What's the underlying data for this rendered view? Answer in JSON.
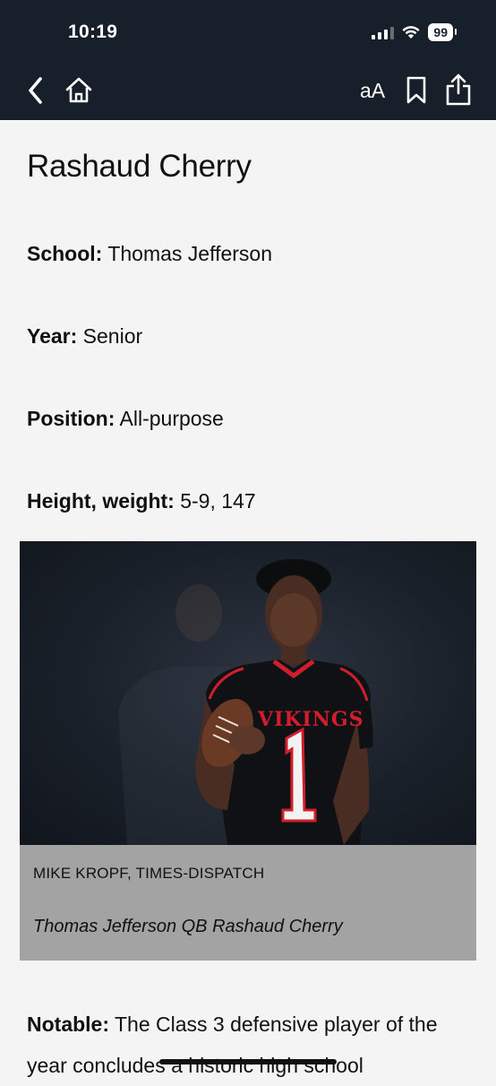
{
  "status_bar": {
    "time": "10:19",
    "battery": "99"
  },
  "toolbar": {
    "back_icon": "chevron-left-icon",
    "home_icon": "home-icon",
    "text_size_label": "aA",
    "bookmark_icon": "bookmark-icon",
    "share_icon": "share-icon"
  },
  "article": {
    "title": "Rashaud Cherry",
    "facts": [
      {
        "label": "School:",
        "value": "Thomas Jefferson"
      },
      {
        "label": "Year:",
        "value": "Senior"
      },
      {
        "label": "Position:",
        "value": "All-purpose"
      },
      {
        "label": "Height, weight:",
        "value": "5-9, 147"
      }
    ],
    "photo": {
      "jersey_text": "VIKINGS",
      "jersey_number": "1",
      "credit": "MIKE KROPF, TIMES-DISPATCH",
      "caption": "Thomas Jefferson QB Rashaud Cherry"
    },
    "notable": {
      "label": "Notable:",
      "text": "The Class 3 defensive player of the year concludes a historic high school"
    }
  },
  "colors": {
    "topbar": "#17202a",
    "page_bg": "#f4f4f4",
    "caption_bg": "#a3a3a3",
    "jersey_red": "#d21e2b"
  }
}
